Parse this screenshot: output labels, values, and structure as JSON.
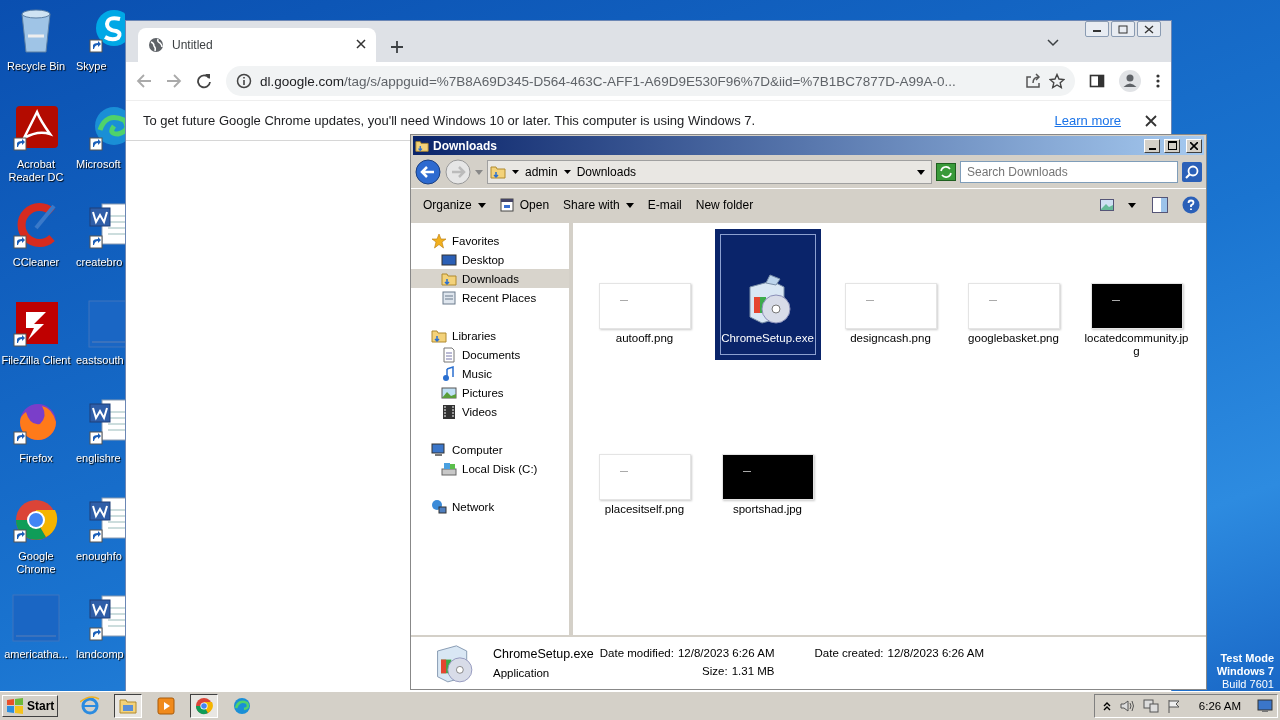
{
  "desktop": {
    "icons": [
      {
        "label": "Recycle Bin",
        "kind": "trash"
      },
      {
        "label": "Skype",
        "kind": "chat"
      },
      {
        "label": "Acrobat Reader DC",
        "kind": "pdf"
      },
      {
        "label": "Microsoft",
        "kind": "swirl"
      },
      {
        "label": "CCleaner",
        "kind": "brush"
      },
      {
        "label": "createbro",
        "kind": "doc"
      },
      {
        "label": "FileZilla Client",
        "kind": "ftp"
      },
      {
        "label": "eastsouth",
        "kind": "blank"
      },
      {
        "label": "Firefox",
        "kind": "fox"
      },
      {
        "label": "englishre",
        "kind": "doc"
      },
      {
        "label": "Google Chrome",
        "kind": "chrome"
      },
      {
        "label": "enoughfo",
        "kind": "doc"
      },
      {
        "label": "americatha...",
        "kind": "blank"
      },
      {
        "label": "landcomp",
        "kind": "doc"
      }
    ],
    "system_text": [
      "Test Mode",
      "Windows 7",
      "Build 7601"
    ]
  },
  "browser": {
    "tabs": [
      {
        "title": "Untitled",
        "selected": true
      }
    ],
    "address": {
      "host": "dl.google.com",
      "path": "/tag/s/appguid=%7B8A69D345-D564-463C-AFF1-A69D9E530F96%7D&iid=%7B1BC7877D-A99A-0..."
    },
    "infobar": {
      "message": "To get future Google Chrome updates, you'll need Windows 10 or later. This computer is using Windows 7.",
      "link": "Learn more"
    }
  },
  "explorer": {
    "title": "Downloads",
    "breadcrumb": [
      "admin",
      "Downloads"
    ],
    "search": {
      "placeholder": "Search Downloads"
    },
    "toolbar": [
      {
        "label": "Organize",
        "kind": "menu"
      },
      {
        "label": "Open",
        "kind": "open"
      },
      {
        "label": "Share with",
        "kind": "menu"
      },
      {
        "label": "E-mail",
        "kind": "plain"
      },
      {
        "label": "New folder",
        "kind": "plain"
      }
    ],
    "nav": [
      {
        "label": "Favorites",
        "kind": "star",
        "selected": false,
        "children": [
          {
            "label": "Desktop",
            "kind": "desktop",
            "selected": false
          },
          {
            "label": "Downloads",
            "kind": "folder",
            "selected": true
          },
          {
            "label": "Recent Places",
            "kind": "recent",
            "selected": false
          }
        ]
      },
      {
        "label": "Libraries",
        "kind": "folder",
        "selected": false,
        "children": [
          {
            "label": "Documents",
            "kind": "document",
            "selected": false
          },
          {
            "label": "Music",
            "kind": "music",
            "selected": false
          },
          {
            "label": "Pictures",
            "kind": "pictures",
            "selected": false
          },
          {
            "label": "Videos",
            "kind": "videos",
            "selected": false
          }
        ]
      },
      {
        "label": "Computer",
        "kind": "computer",
        "selected": false,
        "children": [
          {
            "label": "Local Disk (C:)",
            "kind": "disk",
            "selected": false
          }
        ]
      },
      {
        "label": "Network",
        "kind": "network",
        "selected": false
      }
    ],
    "files": [
      {
        "name": "autooff.png",
        "kind": "white",
        "selected": false
      },
      {
        "name": "ChromeSetup.exe",
        "kind": "installer",
        "selected": true
      },
      {
        "name": "designcash.png",
        "kind": "white",
        "selected": false
      },
      {
        "name": "googlebasket.png",
        "kind": "white",
        "selected": false
      },
      {
        "name": "locatedcommunity.jpg",
        "kind": "black",
        "selected": false
      },
      {
        "name": "placesitself.png",
        "kind": "white",
        "selected": false
      },
      {
        "name": "sportshad.jpg",
        "kind": "black",
        "selected": false
      }
    ],
    "details": {
      "name": "ChromeSetup.exe",
      "type": "Application",
      "fields": [
        {
          "label": "Date modified:",
          "value": "12/8/2023 6:26 AM"
        },
        {
          "label": "Size:",
          "value": "1.31 MB"
        },
        {
          "label": "Date created:",
          "value": "12/8/2023 6:26 AM"
        }
      ]
    }
  },
  "taskbar": {
    "start": "Start",
    "apps": [
      {
        "kind": "ie",
        "selected": false
      },
      {
        "kind": "folder",
        "selected": true
      },
      {
        "kind": "media",
        "selected": false
      },
      {
        "kind": "chrome",
        "selected": true
      },
      {
        "kind": "edge",
        "selected": false
      }
    ],
    "clock": "6:26 AM"
  }
}
